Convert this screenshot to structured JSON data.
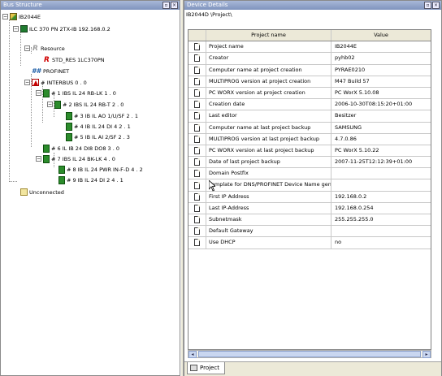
{
  "bus_panel": {
    "title": "Bus Structure",
    "tree": [
      {
        "label": "IB2044E"
      },
      {
        "label": "ILC 370 PN 2TX-IB 192.168.0.2"
      },
      {
        "label": "Resource"
      },
      {
        "label": "STD_RES 1LC370PN"
      },
      {
        "label": "PROFINET"
      },
      {
        "label": "# INTERBUS 0 . 0"
      },
      {
        "label": "# 1 IBS IL 24 RB-LK 1 . 0"
      },
      {
        "label": "# 2 IBS IL 24 RB-T 2 . 0"
      },
      {
        "label": "# 3 IB IL AO 1/U/SF 2 . 1"
      },
      {
        "label": "# 4 IB IL 24 DI 4 2 . 1"
      },
      {
        "label": "# 5 IB IL AI 2/SF 2 . 3"
      },
      {
        "label": "# 6 IL IB 24 DI8 DO8 3 . 0"
      },
      {
        "label": "# 7 IBS IL 24 BK-LK 4 . 0"
      },
      {
        "label": "# 8 IB IL 24 PWR IN-F-D 4 . 2"
      },
      {
        "label": "# 9 IB IL 24 DI 2 4 . 1"
      },
      {
        "label": "Unconnected"
      }
    ]
  },
  "device_panel": {
    "title": "Device Details",
    "path": "IB2044D \\Project\\",
    "columns": {
      "name": "Project name",
      "value": "Value"
    },
    "rows": [
      {
        "name": "Project name",
        "value": "IB2044E"
      },
      {
        "name": "Creator",
        "value": "pyhb02"
      },
      {
        "name": "Computer name at project creation",
        "value": "PYRAE0210"
      },
      {
        "name": "MULTIPROG version at project creation",
        "value": "M47 Build 57"
      },
      {
        "name": "PC WORX version at project creation",
        "value": "PC WorX 5.10.08"
      },
      {
        "name": "Creation date",
        "value": "2006-10-30T08:15:20+01:00"
      },
      {
        "name": "Last editor",
        "value": "Besitzer"
      },
      {
        "name": "Computer name at last project backup",
        "value": "SAMSUNG"
      },
      {
        "name": "MULTIPROG version at last project backup",
        "value": "4.7.0.86"
      },
      {
        "name": "PC WORX version at last project backup",
        "value": "PC WorX 5.10.22"
      },
      {
        "name": "Date of last project backup",
        "value": "2007-11-25T12:12:39+01:00"
      },
      {
        "name": "Domain Postfix",
        "value": ""
      },
      {
        "name": "Template for DNS/PROFINET Device Name gen...",
        "value": ""
      },
      {
        "name": "First IP Address",
        "value": "192.168.0.2"
      },
      {
        "name": "Last IP-Address",
        "value": "192.168.0.254"
      },
      {
        "name": "Subnetmask",
        "value": "255.255.255.0"
      },
      {
        "name": "Default Gateway",
        "value": ""
      },
      {
        "name": "Use DHCP",
        "value": "no"
      }
    ],
    "tab_label": "Project"
  }
}
